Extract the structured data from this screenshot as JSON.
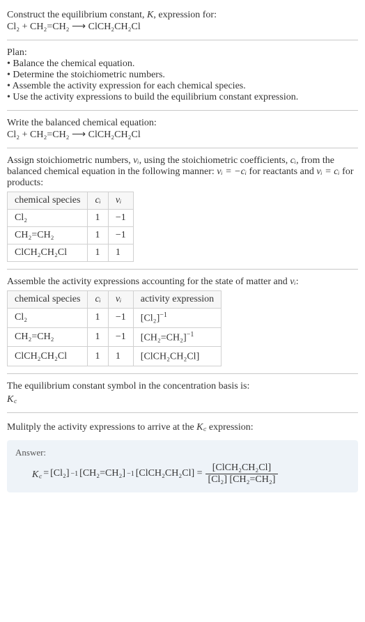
{
  "header": {
    "line1": "Construct the equilibrium constant, ",
    "K": "K",
    "line1b": ", expression for:",
    "eq": "Cl₂ + CH₂=CH₂  ⟶  ClCH₂CH₂Cl"
  },
  "plan": {
    "title": "Plan:",
    "b1": "• Balance the chemical equation.",
    "b2": "• Determine the stoichiometric numbers.",
    "b3": "• Assemble the activity expression for each chemical species.",
    "b4": "• Use the activity expressions to build the equilibrium constant expression."
  },
  "balanced": {
    "title": "Write the balanced chemical equation:",
    "eq": "Cl₂ + CH₂=CH₂  ⟶  ClCH₂CH₂Cl"
  },
  "stoich": {
    "intro1": "Assign stoichiometric numbers, ",
    "nu": "νᵢ",
    "intro2": ", using the stoichiometric coefficients, ",
    "ci": "cᵢ",
    "intro3": ", from the balanced chemical equation in the following manner: ",
    "rule1": "νᵢ = −cᵢ",
    "intro4": " for reactants and ",
    "rule2": "νᵢ = cᵢ",
    "intro5": " for products:",
    "headers": {
      "h1": "chemical species",
      "h2": "cᵢ",
      "h3": "νᵢ"
    },
    "rows": [
      {
        "sp": "Cl₂",
        "c": "1",
        "v": "−1"
      },
      {
        "sp": "CH₂=CH₂",
        "c": "1",
        "v": "−1"
      },
      {
        "sp": "ClCH₂CH₂Cl",
        "c": "1",
        "v": "1"
      }
    ]
  },
  "activity": {
    "title": "Assemble the activity expressions accounting for the state of matter and ",
    "nu": "νᵢ",
    "colon": ":",
    "headers": {
      "h1": "chemical species",
      "h2": "cᵢ",
      "h3": "νᵢ",
      "h4": "activity expression"
    },
    "rows": [
      {
        "sp": "Cl₂",
        "c": "1",
        "v": "−1",
        "ae_base": "[Cl₂]",
        "ae_exp": "−1"
      },
      {
        "sp": "CH₂=CH₂",
        "c": "1",
        "v": "−1",
        "ae_base": "[CH₂=CH₂]",
        "ae_exp": "−1"
      },
      {
        "sp": "ClCH₂CH₂Cl",
        "c": "1",
        "v": "1",
        "ae_base": "[ClCH₂CH₂Cl]",
        "ae_exp": ""
      }
    ]
  },
  "symbol": {
    "line": "The equilibrium constant symbol in the concentration basis is:",
    "kc": "K꜀"
  },
  "multiply": {
    "line1": "Mulitply the activity expressions to arrive at the ",
    "kc": "K꜀",
    "line2": " expression:"
  },
  "answer": {
    "label": "Answer:",
    "kc": "K꜀",
    "eq": " = ",
    "t1": "[Cl₂]",
    "e1": "−1",
    "t2": " [CH₂=CH₂]",
    "e2": "−1",
    "t3": " [ClCH₂CH₂Cl] = ",
    "num": "[ClCH₂CH₂Cl]",
    "den": "[Cl₂] [CH₂=CH₂]"
  }
}
